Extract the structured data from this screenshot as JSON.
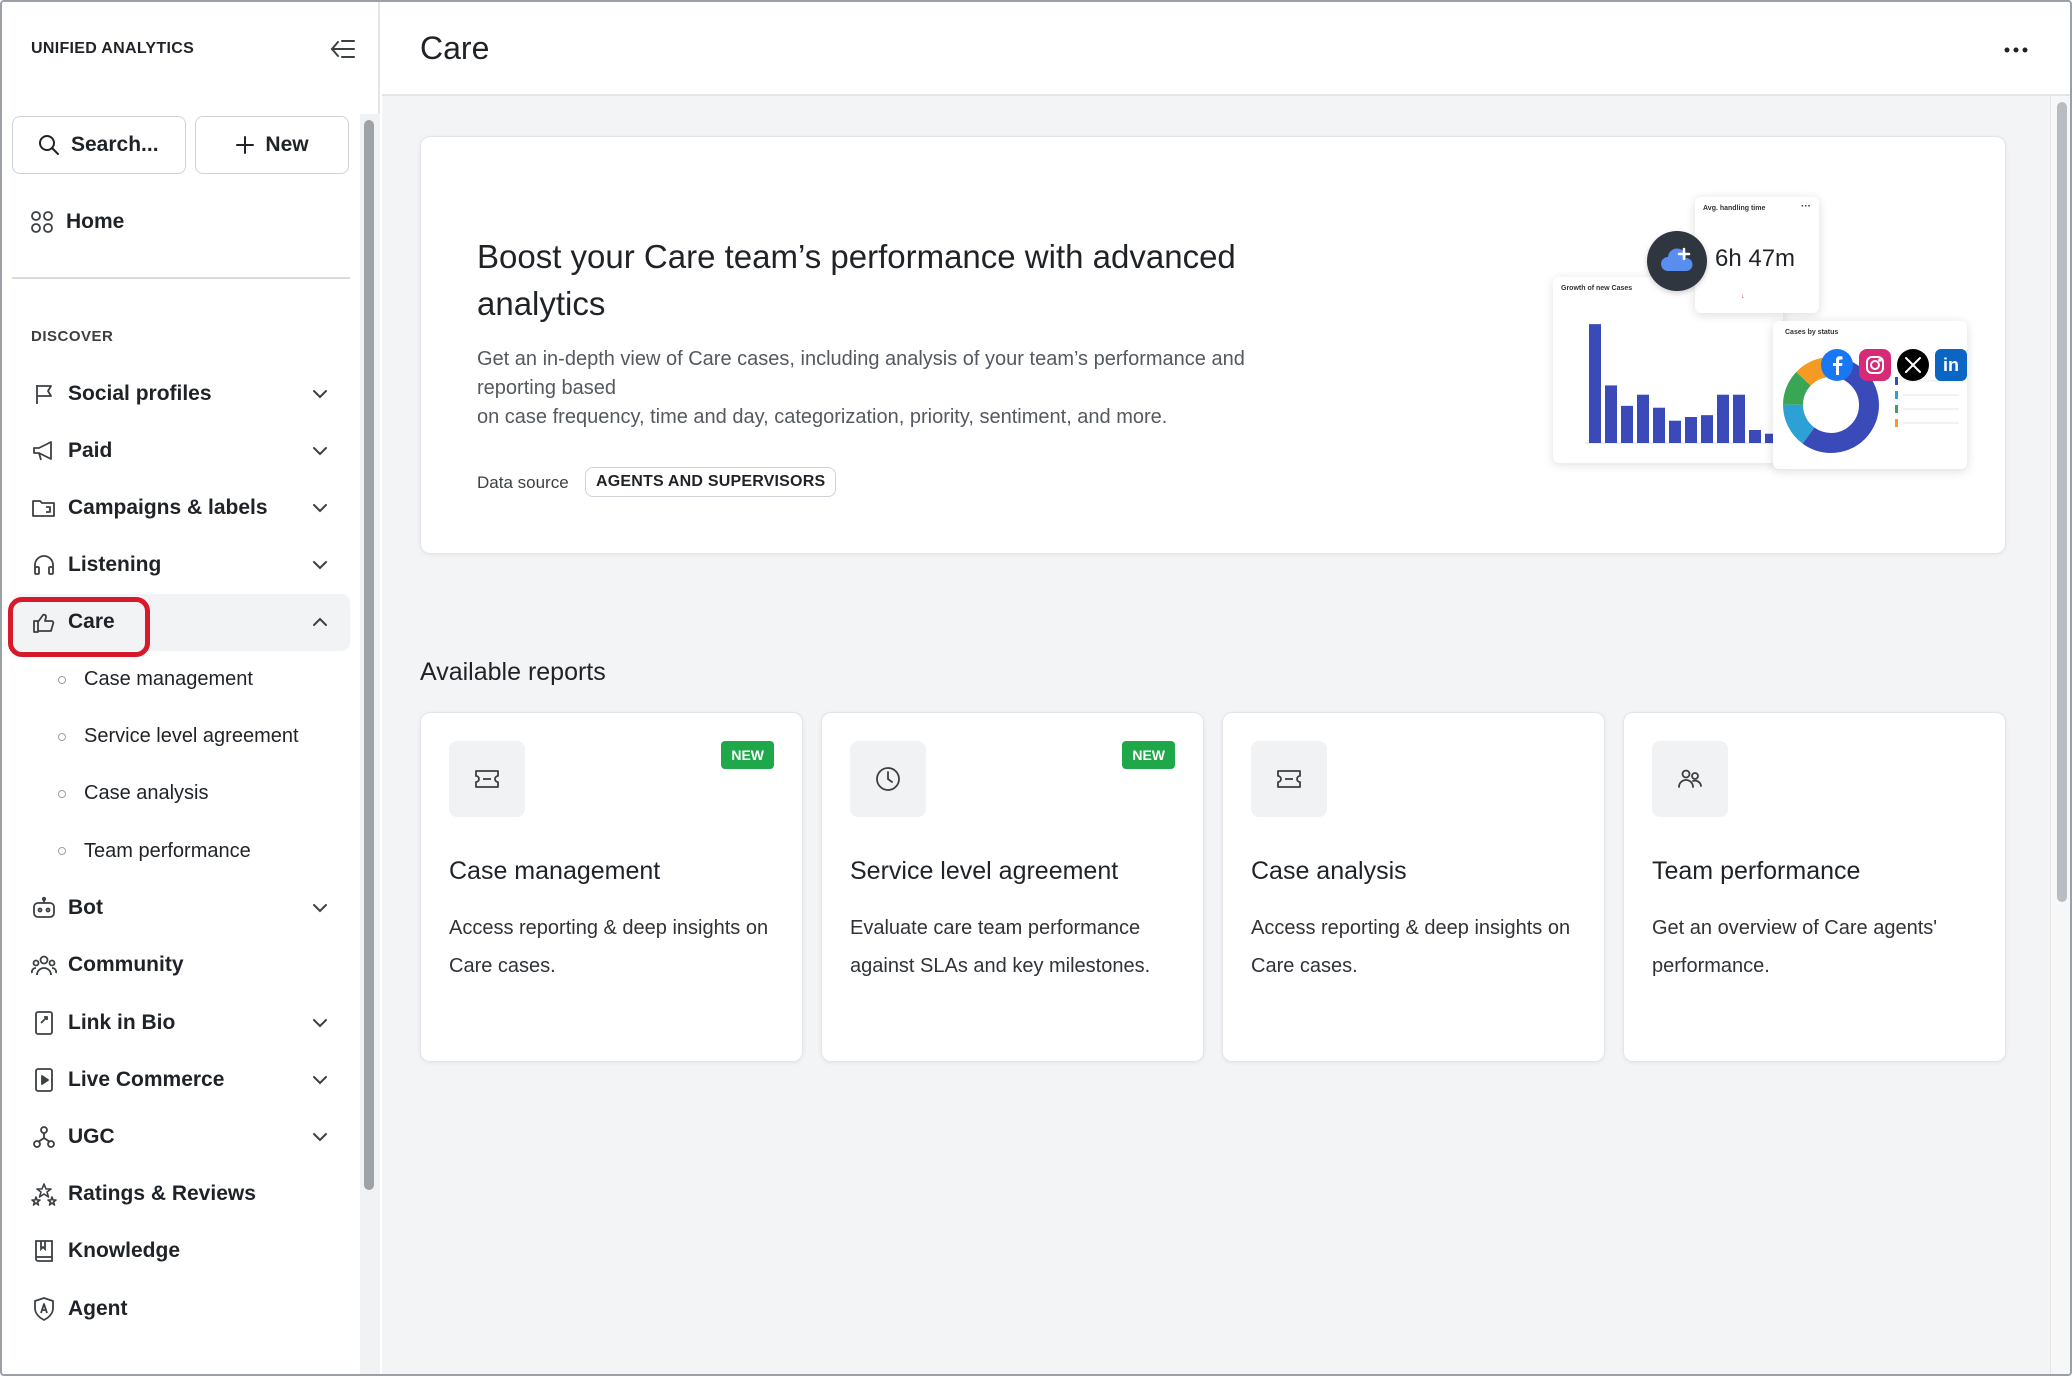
{
  "sidebar": {
    "brand": "UNIFIED ANALYTICS",
    "search_label": "Search...",
    "new_label": "New",
    "home_label": "Home",
    "section_label": "DISCOVER",
    "items": [
      {
        "label": "Social profiles"
      },
      {
        "label": "Paid"
      },
      {
        "label": "Campaigns & labels"
      },
      {
        "label": "Listening"
      },
      {
        "label": "Care"
      },
      {
        "label": "Bot"
      },
      {
        "label": "Community"
      },
      {
        "label": "Link in Bio"
      },
      {
        "label": "Live Commerce"
      },
      {
        "label": "UGC"
      },
      {
        "label": "Ratings & Reviews"
      },
      {
        "label": "Knowledge"
      },
      {
        "label": "Agent"
      }
    ],
    "care_subitems": [
      {
        "label": "Case management"
      },
      {
        "label": "Service level agreement"
      },
      {
        "label": "Case analysis"
      },
      {
        "label": "Team performance"
      }
    ]
  },
  "header": {
    "title": "Care"
  },
  "hero": {
    "title": "Boost your Care team’s performance with advanced analytics",
    "desc_line1": "Get an in-depth view of Care cases, including analysis of your team’s performance and",
    "desc_line2": "reporting based",
    "desc_line3": "on case frequency, time and day, categorization, priority, sentiment, and more.",
    "data_source_label": "Data source",
    "data_source_value": "AGENTS AND SUPERVISORS",
    "illustration": {
      "avg_title": "Avg. handling time",
      "avg_value": "6h 47m",
      "bar_title": "Growth of new Cases",
      "donut_title": "Cases by status",
      "bar_values": [
        128,
        62,
        40,
        52,
        38,
        24,
        28,
        30,
        52,
        52,
        14,
        10
      ],
      "donut_segments": [
        {
          "value": 60,
          "color": "#3a4ab8"
        },
        {
          "value": 15,
          "color": "#2da0d6"
        },
        {
          "value": 12,
          "color": "#3aa655"
        },
        {
          "value": 13,
          "color": "#f59b23"
        }
      ],
      "colors": {
        "bar": "#3a4ab8",
        "facebook": "#1877f2",
        "instagram": "#d62976",
        "x": "#000000",
        "linkedin": "#0a66c2"
      }
    }
  },
  "reports": {
    "section_title": "Available reports",
    "cards": [
      {
        "title": "Case management",
        "desc": "Access reporting & deep insights on Care cases.",
        "badge": "NEW",
        "icon": "ticket-icon"
      },
      {
        "title": "Service level agreement",
        "desc": "Evaluate care team performance against SLAs and key milestones.",
        "badge": "NEW",
        "icon": "clock-icon"
      },
      {
        "title": "Case analysis",
        "desc": "Access reporting & deep insights on Care cases.",
        "badge": "",
        "icon": "ticket-icon"
      },
      {
        "title": "Team performance",
        "desc": "Get an overview of Care agents' performance.",
        "badge": "",
        "icon": "people-icon"
      }
    ]
  }
}
